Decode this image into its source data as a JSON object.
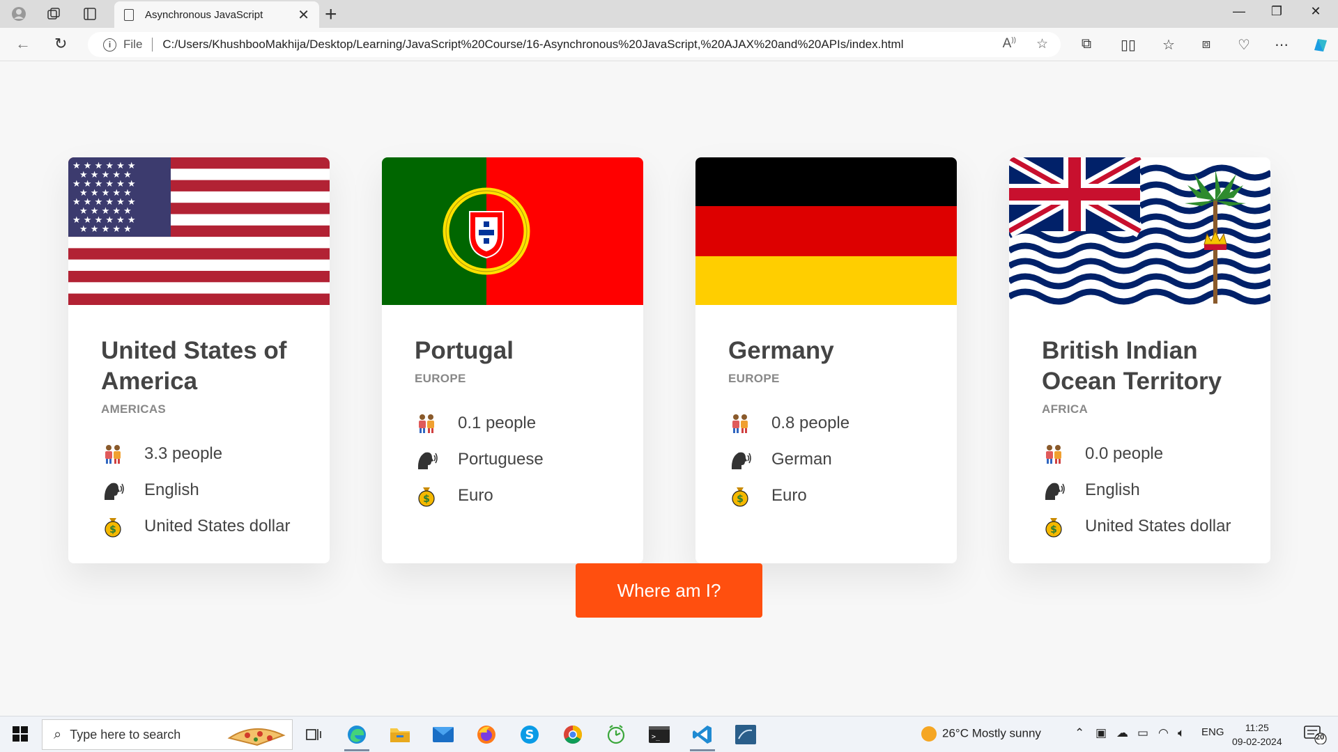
{
  "browser": {
    "tab_title": "Asynchronous JavaScript",
    "tab_close": "✕",
    "new_tab": "+",
    "url_prefix": "File",
    "url": "C:/Users/KhushbooMakhija/Desktop/Learning/JavaScript%20Course/16-Asynchronous%20JavaScript,%20AJAX%20and%20APIs/index.html"
  },
  "countries": [
    {
      "name": "United States of America",
      "region": "AMERICAS",
      "population": "3.3 people",
      "language": "English",
      "currency": "United States dollar",
      "flag": "us-flag"
    },
    {
      "name": "Portugal",
      "region": "EUROPE",
      "population": "0.1 people",
      "language": "Portuguese",
      "currency": "Euro",
      "flag": "portugal-flag"
    },
    {
      "name": "Germany",
      "region": "EUROPE",
      "population": "0.8 people",
      "language": "German",
      "currency": "Euro",
      "flag": "germany-flag"
    },
    {
      "name": "British Indian Ocean Territory",
      "region": "AFRICA",
      "population": "0.0 people",
      "language": "English",
      "currency": "United States dollar",
      "flag": "biot-flag"
    }
  ],
  "button": {
    "label": "Where am I?",
    "color": "#ff4f0f"
  },
  "taskbar": {
    "search_placeholder": "Type here to search",
    "weather": "26°C  Mostly sunny",
    "lang": "ENG",
    "time": "11:25",
    "date": "09-02-2024",
    "notif_count": "20"
  }
}
